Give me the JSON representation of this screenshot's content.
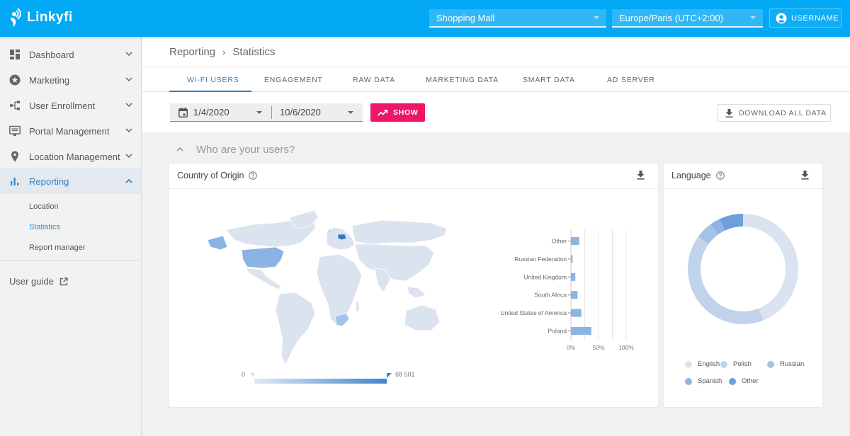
{
  "app": {
    "brand": "Linkyfi",
    "venue_select": "Shopping Mall",
    "timezone_select": "Europe/Paris (UTC+2:00)",
    "user_label": "USERNAME"
  },
  "sidebar": {
    "items": [
      {
        "label": "Dashboard",
        "icon": "dashboard-icon",
        "expanded": false
      },
      {
        "label": "Marketing",
        "icon": "star-badge-icon",
        "expanded": false
      },
      {
        "label": "User Enrollment",
        "icon": "tree-nodes-icon",
        "expanded": false
      },
      {
        "label": "Portal Management",
        "icon": "monitor-icon",
        "expanded": false
      },
      {
        "label": "Location Management",
        "icon": "location-pin-icon",
        "expanded": false
      },
      {
        "label": "Reporting",
        "icon": "bar-chart-icon",
        "expanded": true,
        "active": true
      }
    ],
    "sub_items": [
      {
        "label": "Location"
      },
      {
        "label": "Statistics",
        "active": true
      },
      {
        "label": "Report manager"
      }
    ],
    "user_guide": "User guide"
  },
  "header": {
    "breadcrumb": [
      "Reporting",
      "Statistics"
    ],
    "tabs": [
      {
        "label": "WI-FI USERS",
        "active": true
      },
      {
        "label": "ENGAGEMENT"
      },
      {
        "label": "RAW DATA"
      },
      {
        "label": "MARKETING DATA"
      },
      {
        "label": "SMART DATA"
      },
      {
        "label": "AD SERVER"
      }
    ],
    "date_from": "1/4/2020",
    "date_to": "10/6/2020",
    "show_label": "SHOW",
    "download_all_label": "DOWNLOAD ALL DATA"
  },
  "section": {
    "title": "Who are your users?"
  },
  "colors": {
    "brand": "#03a9f4",
    "accent": "#ef1667",
    "active_blue": "#2f7fc1",
    "bar": "#8cb3e3",
    "map_base": "#dbe3ef"
  },
  "country_card": {
    "title": "Country of Origin",
    "scale_min": "0",
    "scale_max": "68 501"
  },
  "language_card": {
    "title": "Language"
  },
  "chart_data": [
    {
      "type": "bar",
      "orientation": "horizontal",
      "title": "Country of Origin",
      "categories": [
        "Other",
        "Russian Federation",
        "United Kingdom",
        "South Africa",
        "United States of America",
        "Poland"
      ],
      "values": [
        15,
        3,
        8,
        12,
        19,
        37
      ],
      "unit": "%",
      "xlim": [
        0,
        100
      ],
      "xticks": [
        "0%",
        "50%",
        "100%"
      ],
      "grid": true
    },
    {
      "type": "pie",
      "variant": "donut",
      "title": "Language",
      "categories": [
        "English",
        "Polish",
        "Russian",
        "Spanish",
        "Other"
      ],
      "values": [
        44,
        41,
        5,
        3,
        7
      ],
      "colors": [
        "#dae3ef",
        "#c0d3ea",
        "#a5c1e6",
        "#8fb3e4",
        "#6d9fdc"
      ],
      "legend": "bottom"
    },
    {
      "type": "heatmap",
      "variant": "choropleth-world-map",
      "title": "Country of Origin",
      "highlighted": [
        {
          "country": "Poland",
          "level": "highest"
        },
        {
          "country": "United States of America",
          "level": "medium"
        },
        {
          "country": "South Africa",
          "level": "low"
        },
        {
          "country": "United Kingdom",
          "level": "low"
        },
        {
          "country": "Russian Federation",
          "level": "low"
        }
      ],
      "scale_range": [
        0,
        68501
      ]
    }
  ]
}
